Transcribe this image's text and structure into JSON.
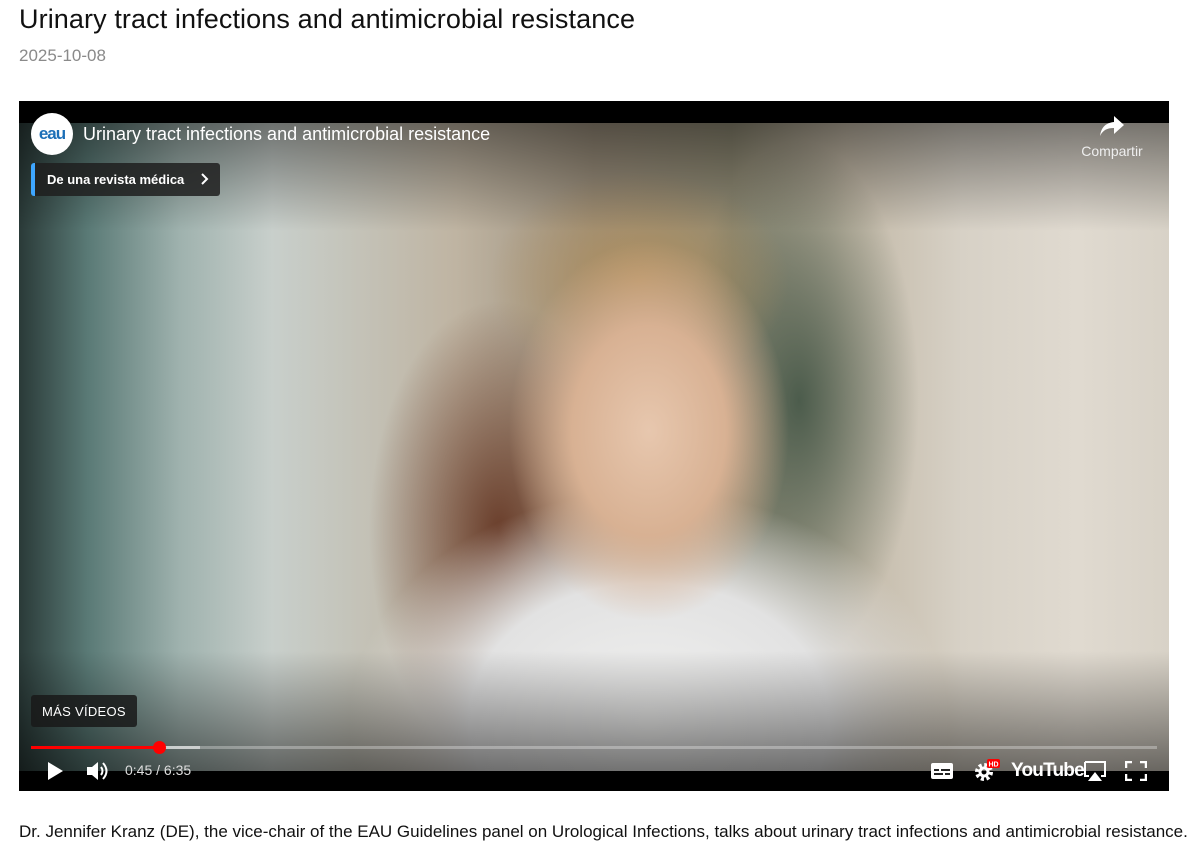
{
  "page": {
    "title": "Urinary tract infections and antimicrobial resistance",
    "date": "2025-10-08",
    "caption": "Dr. Jennifer Kranz (DE), the vice-chair of the EAU Guidelines panel on Urological Infections, talks about urinary tract infections and antimicrobial resistance."
  },
  "player": {
    "channel_logo_text": "eau",
    "video_title": "Urinary tract infections and antimicrobial resistance",
    "share_label": "Compartir",
    "source_chip": "De una revista médica",
    "more_videos": "MÁS VÍDEOS",
    "time": "0:45 / 6:35",
    "progress_fraction": 0.114,
    "buffer_fraction": 0.15,
    "wordmark": "YouTube",
    "hd_badge": "HD",
    "accent_color": "#ff0000",
    "icons": [
      "play-icon",
      "volume-icon",
      "subtitles-icon",
      "settings-icon",
      "airplay-icon",
      "fullscreen-icon",
      "share-icon",
      "chevron-right-icon"
    ]
  }
}
